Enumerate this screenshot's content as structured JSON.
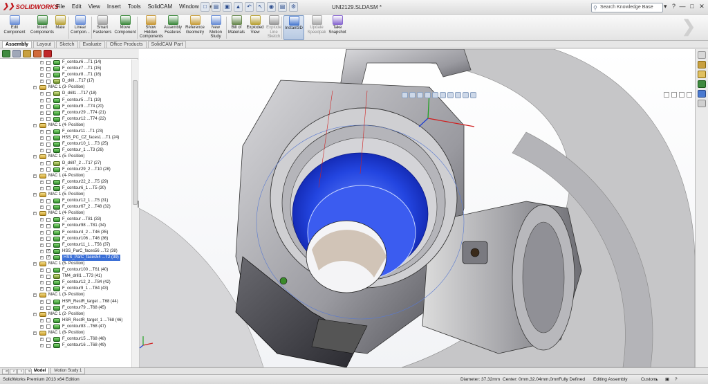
{
  "app": {
    "title": "UNI2129.SLDASM *"
  },
  "logo": {
    "brand": "SOLIDWORKS"
  },
  "menu": [
    "File",
    "Edit",
    "View",
    "Insert",
    "Tools",
    "SolidCAM",
    "Window",
    "Help"
  ],
  "search": {
    "placeholder": "Search Knowledge Base"
  },
  "ribbon": [
    {
      "label": "Edit\nComponent",
      "color": "#6b8fd6"
    },
    {
      "label": "Insert\nComponents",
      "color": "#3f8a3f"
    },
    {
      "label": "Mate",
      "color": "#b9a33a"
    },
    {
      "label": "Linear\nCompon...",
      "color": "#6b8fd6"
    },
    {
      "label": "Smart\nFasteners",
      "color": "#a0a0a0"
    },
    {
      "label": "Move\nComponent",
      "color": "#3f8a3f"
    },
    {
      "label": "Show\nHidden\nComponents",
      "color": "#c89a3a"
    },
    {
      "label": "Assembly\nFeatures",
      "color": "#3f8a3f"
    },
    {
      "label": "Reference\nGeometry",
      "color": "#c8a040"
    },
    {
      "label": "New\nMotion\nStudy",
      "color": "#6b8fd6"
    },
    {
      "label": "Bill of\nMaterials",
      "color": "#6a8a50"
    },
    {
      "label": "Exploded\nView",
      "color": "#b9a33a"
    },
    {
      "label": "Explode\nLine\nSketch",
      "color": "#9a9a9a"
    },
    {
      "label": "Instant3D",
      "color": "#4a7ad0"
    },
    {
      "label": "Update\nSpeedpak",
      "color": "#a8a8a8"
    },
    {
      "label": "Take\nSnapshot",
      "color": "#8a6ad0"
    }
  ],
  "cm_tabs": [
    "Assembly",
    "Layout",
    "Sketch",
    "Evaluate",
    "Office Products",
    "SolidCAM Part"
  ],
  "tree": [
    {
      "t": "F_contour6 ...T1 (14)",
      "lv": 1,
      "ic": "op",
      "ex": true
    },
    {
      "t": "F_contour7 ...T1 (15)",
      "lv": 1,
      "ic": "op",
      "ex": true
    },
    {
      "t": "F_contour8 ...T1 (16)",
      "lv": 1,
      "ic": "op",
      "ex": true
    },
    {
      "t": "D_drill ...T17 (17)",
      "lv": 1,
      "ic": "dr",
      "ex": true
    },
    {
      "t": "MAC 1 (3- Position)",
      "lv": 0,
      "ic": "mac",
      "ex": true
    },
    {
      "t": "D_drill1 ...T17 (18)",
      "lv": 1,
      "ic": "dr",
      "ex": true
    },
    {
      "t": "F_contour5 ...T1 (19)",
      "lv": 1,
      "ic": "op",
      "ex": true
    },
    {
      "t": "F_contour9 ...T74 (20)",
      "lv": 1,
      "ic": "op",
      "ex": true
    },
    {
      "t": "F_contour29 ...T74 (21)",
      "lv": 1,
      "ic": "op",
      "ex": true
    },
    {
      "t": "F_contour12 ...T74 (22)",
      "lv": 1,
      "ic": "op",
      "ex": true
    },
    {
      "t": "MAC 1 (4- Position)",
      "lv": 0,
      "ic": "mac",
      "ex": true
    },
    {
      "t": "F_contour11 ...T1 (23)",
      "lv": 1,
      "ic": "op",
      "ex": true
    },
    {
      "t": "HSS_PC_CZ_faces1 ...T1 (24)",
      "lv": 1,
      "ic": "op",
      "ex": true
    },
    {
      "t": "F_contour10_1 ...T3 (25)",
      "lv": 1,
      "ic": "op",
      "ex": true
    },
    {
      "t": "F_contour_1 ...T3 (26)",
      "lv": 1,
      "ic": "op",
      "ex": true
    },
    {
      "t": "MAC 1 (5- Position)",
      "lv": 0,
      "ic": "mac",
      "ex": true
    },
    {
      "t": "D_drill7_2 ...T17 (27)",
      "lv": 1,
      "ic": "dr",
      "ex": true
    },
    {
      "t": "F_contour29_2 ...T10 (28)",
      "lv": 1,
      "ic": "op",
      "ex": true
    },
    {
      "t": "MAC 1 (4- Position)",
      "lv": 0,
      "ic": "mac",
      "ex": true
    },
    {
      "t": "F_contour22_2 ...T5 (29)",
      "lv": 1,
      "ic": "op",
      "ex": true
    },
    {
      "t": "F_contour6_1 ...T5 (30)",
      "lv": 1,
      "ic": "op",
      "ex": true
    },
    {
      "t": "MAC 1 (5- Position)",
      "lv": 0,
      "ic": "mac",
      "ex": true
    },
    {
      "t": "F_contour12_1 ...T5 (31)",
      "lv": 1,
      "ic": "op",
      "ex": true
    },
    {
      "t": "F_contour67_2 ...T48 (32)",
      "lv": 1,
      "ic": "op",
      "ex": true
    },
    {
      "t": "MAC 1 (4- Position)",
      "lv": 0,
      "ic": "mac",
      "ex": true
    },
    {
      "t": "F_contour ...T81 (33)",
      "lv": 1,
      "ic": "op",
      "ex": true
    },
    {
      "t": "F_contour98 ...T81 (34)",
      "lv": 1,
      "ic": "op",
      "ex": true
    },
    {
      "t": "F_contour4_2 ...T46 (35)",
      "lv": 1,
      "ic": "op",
      "ex": true
    },
    {
      "t": "F_contour106 ...T46 (36)",
      "lv": 1,
      "ic": "op",
      "ex": true
    },
    {
      "t": "F_contour11_1 ...T56 (37)",
      "lv": 1,
      "ic": "op",
      "ex": true
    },
    {
      "t": "HSS_ParC_faces56 ...T2 (38)",
      "lv": 1,
      "ic": "op",
      "ex": true,
      "chk": true
    },
    {
      "t": "HSS_ParC_faces54 ...T2 (39)",
      "lv": 1,
      "ic": "op",
      "ex": true,
      "chk": true,
      "sel": true
    },
    {
      "t": "MAC 1 (5- Position)",
      "lv": 0,
      "ic": "mac",
      "ex": true
    },
    {
      "t": "F_contour100 ...T61 (40)",
      "lv": 1,
      "ic": "op",
      "ex": true
    },
    {
      "t": "TM4_drill1 ...T73 (41)",
      "lv": 1,
      "ic": "dr",
      "ex": true
    },
    {
      "t": "F_contour12_2 ...T84 (42)",
      "lv": 1,
      "ic": "op",
      "ex": true
    },
    {
      "t": "F_contour9_1 ...T84 (43)",
      "lv": 1,
      "ic": "op",
      "ex": true
    },
    {
      "t": "MAC 1 (3- Position)",
      "lv": 0,
      "ic": "mac",
      "ex": true
    },
    {
      "t": "HSR_RestR_target ...T68 (44)",
      "lv": 1,
      "ic": "op",
      "ex": true
    },
    {
      "t": "F_contour79 ...T68 (45)",
      "lv": 1,
      "ic": "op",
      "ex": true
    },
    {
      "t": "MAC 1 (2- Position)",
      "lv": 0,
      "ic": "mac",
      "ex": true
    },
    {
      "t": "HSR_RestR_target_1 ...T68 (46)",
      "lv": 1,
      "ic": "op",
      "ex": true
    },
    {
      "t": "F_contour83 ...T68 (47)",
      "lv": 1,
      "ic": "op",
      "ex": true
    },
    {
      "t": "MAC 1 (6- Position)",
      "lv": 0,
      "ic": "mac",
      "ex": true
    },
    {
      "t": "F_contour15 ...T68 (48)",
      "lv": 1,
      "ic": "op",
      "ex": true
    },
    {
      "t": "F_contour16 ...T68 (49)",
      "lv": 1,
      "ic": "op",
      "ex": true
    }
  ],
  "bottom_tabs": [
    "Model",
    "Motion Study 1"
  ],
  "status": {
    "edition": "SolidWorks Premium 2013 x64 Edition",
    "diameter": "Diameter: 37.32mm",
    "center": "Center: 0mm,32.04mm,0mm",
    "defined": "Fully Defined",
    "mode": "Editing Assembly",
    "units": "Custom"
  },
  "colors": {
    "selection": "#3b6fd6",
    "toolpath": "#2345e0"
  },
  "icons": {
    "search": "search-icon",
    "help": "help-icon"
  }
}
